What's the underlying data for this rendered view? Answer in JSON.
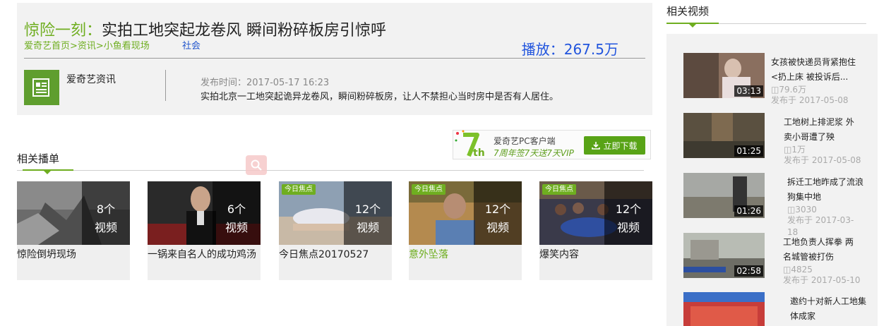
{
  "video": {
    "title_prefix": "惊险一刻：",
    "title_main": "实拍工地突起龙卷风 瞬间粉碎板房引惊呼",
    "breadcrumb": "爱奇艺首页>资讯>小鱼看现场",
    "tag": "社会",
    "play_count": "播放：267.5万",
    "channel_name": "爱奇艺资讯",
    "publish_time": "发布时间：2017-05-17 16:23",
    "description": "实拍北京一工地突起诡异龙卷风，瞬间粉碎板房，让人不禁担心当时房中是否有人居住。"
  },
  "client_banner": {
    "title": "爱奇艺PC客户端",
    "subtitle": "7周年签7天送7天VIP",
    "button": "立即下载",
    "logo_text": "7th"
  },
  "playlists": {
    "heading": "相关播单",
    "items": [
      {
        "count": "8个",
        "unit": "视频",
        "title": "惊险倒坍现场"
      },
      {
        "count": "6个",
        "unit": "视频",
        "title": "一锅来自名人的成功鸡汤"
      },
      {
        "count": "12个",
        "unit": "视频",
        "title": "今日焦点20170527",
        "badge": "今日焦点"
      },
      {
        "count": "12个",
        "unit": "视频",
        "title": "意外坠落",
        "badge": "今日焦点"
      },
      {
        "count": "12个",
        "unit": "视频",
        "title": "爆笑内容",
        "badge": "今日焦点"
      }
    ]
  },
  "related_videos": {
    "heading": "相关视频",
    "items": [
      {
        "title": "女孩被快递员背紧抱住<扔上床 被投诉后...",
        "duration": "03:13",
        "views": "79.6万",
        "date": "发布于 2017-05-08"
      },
      {
        "title": "工地树上排泥浆 外卖小哥遭了殃",
        "duration": "01:25",
        "views": "1万",
        "date": "发布于 2017-05-08"
      },
      {
        "title": "拆迁工地昨成了流浪狗集中地",
        "duration": "01:26",
        "views": "3030",
        "date": "发布于 2017-03-18"
      },
      {
        "title": "工地负责人挥拳 两名城管被打伤",
        "duration": "02:58",
        "views": "4825",
        "date": "发布于 2017-05-10"
      },
      {
        "title": "邀约十对新人工地集体成家",
        "duration": "",
        "views": "",
        "date": ""
      }
    ]
  }
}
